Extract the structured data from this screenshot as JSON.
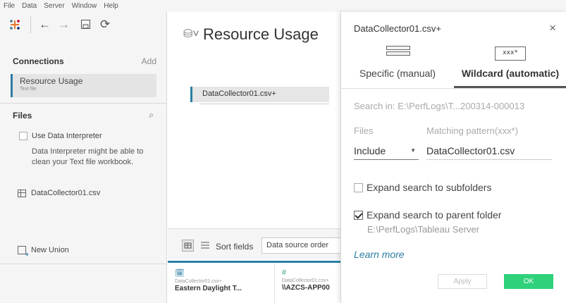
{
  "menubar": {
    "items": [
      "File",
      "Data",
      "Server",
      "Window",
      "Help"
    ]
  },
  "toolbar": {
    "icons": [
      "tableau-logo-icon",
      "back-arrow-icon",
      "forward-arrow-icon",
      "save-icon",
      "refresh-icon"
    ]
  },
  "sidebar": {
    "connections_title": "Connections",
    "add_label": "Add",
    "connection": {
      "name": "Resource Usage",
      "type": "Text file"
    },
    "files_title": "Files",
    "use_interpreter": "Use Data Interpreter",
    "interpreter_note": "Data Interpreter might be able to clean your Text file workbook.",
    "file_item": "DataCollector01.csv",
    "new_union": "New Union"
  },
  "main": {
    "title": "Resource Usage",
    "table_pill": "DataCollector01.csv+",
    "sort_label": "Sort fields",
    "sort_value": "Data source order",
    "columns": [
      {
        "icon": "calendar-icon",
        "source": "DataCollector01.csv+",
        "header": "Eastern Daylight T..."
      },
      {
        "icon": "hash-icon",
        "source": "DataCollector01.csv+",
        "header": "\\\\AZCS-APP00"
      }
    ]
  },
  "panel": {
    "title": "DataCollector01.csv+",
    "close_glyph": "×",
    "tabs": [
      {
        "label": "Specific (manual)",
        "icon": "manual-list-icon"
      },
      {
        "label": "Wildcard (automatic)",
        "icon": "wildcard-icon",
        "icon_text": "xxx*"
      }
    ],
    "search_in": "Search in:  E:\\PerfLogs\\T...200314-000013",
    "files_label": "Files",
    "matching_label": "Matching pattern(xxx*)",
    "include_value": "Include",
    "pattern_value": "DataCollector01.csv",
    "expand_sub": "Expand search to subfolders",
    "expand_sub_checked": false,
    "expand_parent": "Expand search to parent folder",
    "expand_parent_checked": true,
    "parent_path": "E:\\PerfLogs\\Tableau Server",
    "learn_more": "Learn more",
    "apply_label": "Apply",
    "ok_label": "OK"
  },
  "colors": {
    "accent": "#2d7ea5",
    "ok_button": "#2fd17b"
  }
}
